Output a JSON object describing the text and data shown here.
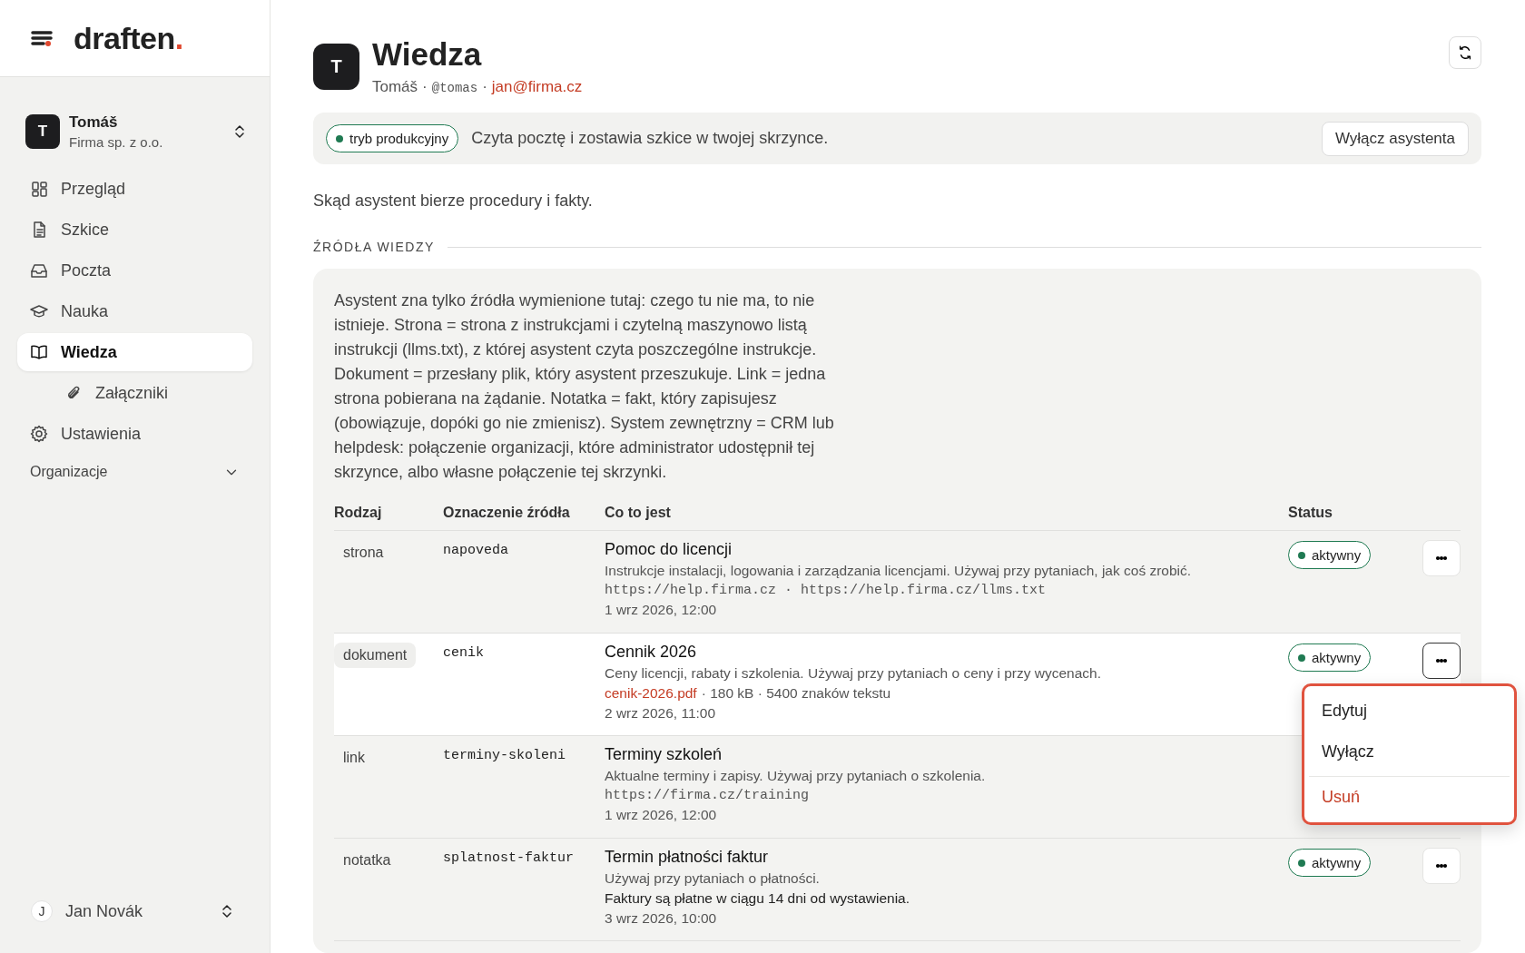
{
  "sidebar": {
    "logo": {
      "text": "draften",
      "dot": "."
    },
    "workspace": {
      "avatar": "T",
      "name": "Tomáš",
      "org": "Firma sp. z o.o."
    },
    "nav": [
      {
        "label": "Przegląd",
        "selected": false
      },
      {
        "label": "Szkice",
        "selected": false
      },
      {
        "label": "Poczta",
        "selected": false
      },
      {
        "label": "Nauka",
        "selected": false
      },
      {
        "label": "Wiedza",
        "selected": true,
        "children": [
          {
            "label": "Załączniki",
            "selected": false
          }
        ]
      },
      {
        "label": "Ustawienia",
        "selected": false
      }
    ],
    "section": {
      "label": "Organizacje",
      "expanded": false
    },
    "user": {
      "avatar": "J",
      "name": "Jan Novák"
    }
  },
  "header": {
    "avatar": "T",
    "title": "Wiedza",
    "subtitle": [
      {
        "kind": "name",
        "text": "Tomáš"
      },
      {
        "kind": "sep",
        "text": "·"
      },
      {
        "kind": "handle",
        "text": "@tomas"
      },
      {
        "kind": "sep",
        "text": "·"
      },
      {
        "kind": "email",
        "text": "jan@firma.cz"
      }
    ]
  },
  "banner": {
    "badge": "tryb produkcyjny",
    "text": "Czyta pocztę i zostawia szkice w twojej skrzynce.",
    "button": "Wyłącz asystenta"
  },
  "intro": "Skąd asystent bierze procedury i fakty.",
  "section_title": "ŹRÓDŁA WIEDZY",
  "description": "Asystent zna tylko źródła wymienione tutaj: czego tu nie ma, to nie istnieje. Strona = strona z instrukcjami i czytelną maszynowo listą instrukcji (llms.txt), z której asystent czyta poszczególne instrukcje. Dokument = przesłany plik, który asystent przeszukuje. Link = jedna strona pobierana na żądanie. Notatka = fakt, który zapisujesz (obowiązuje, dopóki go nie zmienisz). System zewnętrzny = CRM lub helpdesk: połączenie organizacji, które administrator udostępnił tej skrzynce, albo własne połączenie tej skrzynki.",
  "table": {
    "columns": [
      "Rodzaj",
      "Oznaczenie źródła",
      "Co to jest",
      "Status"
    ],
    "rows": [
      {
        "kind": "strona",
        "source_id": "napoveda",
        "title": "Pomoc do licencji",
        "summary": "Instrukcje instalacji, logowania i zarządzania licencjami. Używaj przy pytaniach, jak coś zrobić.",
        "details": [
          {
            "kind": "url",
            "text": "https://help.firma.cz · https://help.firma.cz/llms.txt"
          }
        ],
        "date": "1 wrz 2026, 12:00",
        "status": "aktywny",
        "selected": false,
        "menu_open": false
      },
      {
        "kind": "dokument",
        "source_id": "cenik",
        "title": "Cennik 2026",
        "summary": "Ceny licencji, rabaty i szkolenia. Używaj przy pytaniach o ceny i przy wycenach.",
        "details": [
          {
            "kind": "file",
            "text": "cenik-2026.pdf"
          },
          {
            "kind": "meta",
            "text": "· 180 kB · 5400 znaków tekstu"
          }
        ],
        "date": "2 wrz 2026, 11:00",
        "status": "aktywny",
        "selected": true,
        "menu_open": true
      },
      {
        "kind": "link",
        "source_id": "terminy-skoleni",
        "title": "Terminy szkoleń",
        "summary": "Aktualne terminy i zapisy. Używaj przy pytaniach o szkolenia.",
        "details": [
          {
            "kind": "url",
            "text": "https://firma.cz/training"
          }
        ],
        "date": "1 wrz 2026, 12:00",
        "selected": false
      },
      {
        "kind": "notatka",
        "source_id": "splatnost-faktur",
        "title": "Termin płatności faktur",
        "summary": "Używaj przy pytaniach o płatności.",
        "details": [
          {
            "kind": "note",
            "text": "Faktury są płatne w ciągu 14 dni od wystawienia."
          }
        ],
        "date": "3 wrz 2026, 10:00",
        "status": "aktywny",
        "selected": false,
        "menu_open": false
      }
    ]
  },
  "row_menu": [
    {
      "label": "Edytuj",
      "kind": "normal"
    },
    {
      "label": "Wyłącz",
      "kind": "normal"
    },
    {
      "label": "Usuń",
      "kind": "danger"
    }
  ]
}
